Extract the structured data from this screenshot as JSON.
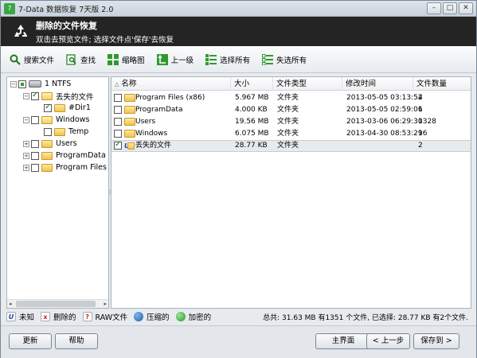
{
  "window": {
    "title": "7-Data 数据恢复 7天版 2.0",
    "controls": {
      "minimize": "–",
      "maximize": "□",
      "close": "✕"
    }
  },
  "banner": {
    "title": "删除的文件恢复",
    "subtitle": "双击去预览文件; 选择文件点'保存'去恢复"
  },
  "toolbar": {
    "search": "搜索文件",
    "find": "查找",
    "thumbnail": "缩略图",
    "up": "上一级",
    "select_all": "选择所有",
    "deselect_all": "失选所有"
  },
  "tree": {
    "items": [
      {
        "label": "1 NTFS"
      },
      {
        "label": "丢失的文件"
      },
      {
        "label": "#Dir1"
      },
      {
        "label": "Windows"
      },
      {
        "label": "Temp"
      },
      {
        "label": "Users"
      },
      {
        "label": "ProgramData"
      },
      {
        "label": "Program Files ("
      }
    ]
  },
  "table": {
    "columns": [
      "名称",
      "大小",
      "文件类型",
      "修改时间",
      "文件数量"
    ],
    "rows": [
      {
        "name": "Program Files (x86)",
        "size": "5.967 MB",
        "type": "文件夹",
        "modified": "2013-05-05 03:13:52",
        "count": "4"
      },
      {
        "name": "ProgramData",
        "size": "4.000 KB",
        "type": "文件夹",
        "modified": "2013-05-05 02:59:06",
        "count": "1"
      },
      {
        "name": "Users",
        "size": "19.56 MB",
        "type": "文件夹",
        "modified": "2013-03-06 06:29:30",
        "count": "1328"
      },
      {
        "name": "Windows",
        "size": "6.075 MB",
        "type": "文件夹",
        "modified": "2013-04-30 08:53:29",
        "count": "16"
      },
      {
        "name": "丢失的文件",
        "size": "28.77 KB",
        "type": "文件夹",
        "modified": "",
        "count": "2"
      }
    ]
  },
  "legend": {
    "unknown": "未知",
    "deleted": "删除的",
    "raw": "RAW文件",
    "compressed": "压缩的",
    "encrypted": "加密的",
    "unknown_glyph": "U",
    "deleted_glyph": "x",
    "raw_glyph": "?"
  },
  "summary": "总共: 31.63 MB 有1351 个文件, 已选择: 28.77 KB 有2个文件.",
  "buttons": {
    "update": "更新",
    "help": "帮助",
    "home": "主界面",
    "back": "< 上一步",
    "save": "保存到 >"
  },
  "colors": {
    "banner_bg": "#242424",
    "accent_green": "#2e9a2e"
  }
}
